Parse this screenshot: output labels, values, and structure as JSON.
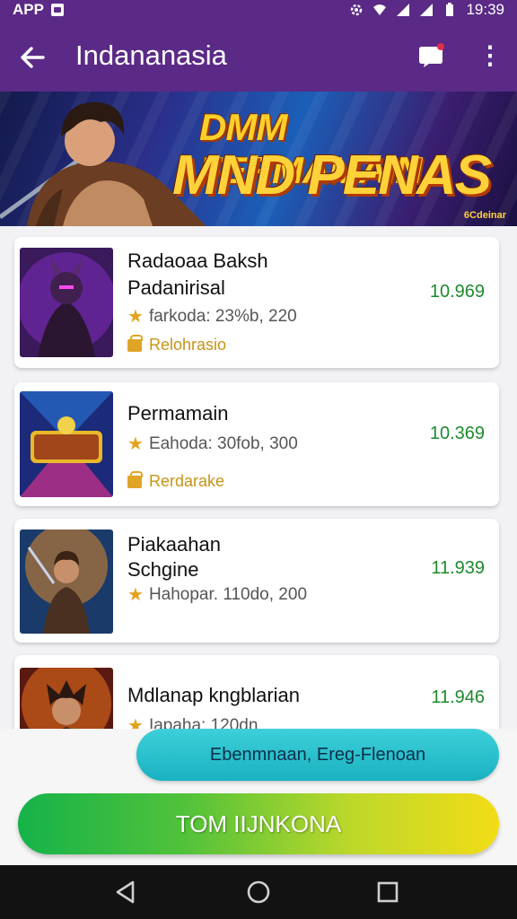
{
  "status_bar": {
    "left_text": "APP",
    "time": "19:39",
    "icons": [
      "photo-icon",
      "gear-icon",
      "wifi-icon",
      "signal-icon",
      "signal-icon",
      "battery-icon"
    ]
  },
  "app_bar": {
    "title": "Indananasia",
    "back_icon": "arrow-left-icon",
    "chat_icon": "chat-bubble-icon",
    "more_icon": "more-vert-icon"
  },
  "banner": {
    "line1": "DMM FERMAMAIN",
    "line2": "MND PENAS",
    "corner_tag": "6Cdeinar"
  },
  "games": [
    {
      "title_line1": "Radaoaa Baksh",
      "title_line2": "Padanirisal",
      "meta": "farkoda: 23%b, 220",
      "tag": "Relohrasio",
      "price": "10.969"
    },
    {
      "title_line1": "Permamain",
      "title_line2": "",
      "meta": "Eahoda: 30fob, 300",
      "tag": "Rerdarake",
      "price": "10.369"
    },
    {
      "title_line1": "Piakaahan",
      "title_line2": "Schgine",
      "meta": "Hahopar. 110do, 200",
      "tag": "",
      "price": "11.939"
    },
    {
      "title_line1": "Mdlanap kngblarian",
      "title_line2": "",
      "meta": "Iapaha: 120dn",
      "tag": "",
      "price": "11.946"
    }
  ],
  "buttons": {
    "secondary_label": "Ebenmnaan, Ereg-Flenoan",
    "primary_label": "TOM IIJNKONA"
  },
  "nav_bar": {
    "icons": [
      "back-triangle-icon",
      "home-circle-icon",
      "recents-square-icon"
    ]
  },
  "colors": {
    "primary": "#5b2a86",
    "price_green": "#1d8a2c",
    "star": "#e3a21a",
    "button_cyan": "#2cc2cf",
    "button_gradient_start": "#14b34a",
    "button_gradient_end": "#f2dc16"
  }
}
